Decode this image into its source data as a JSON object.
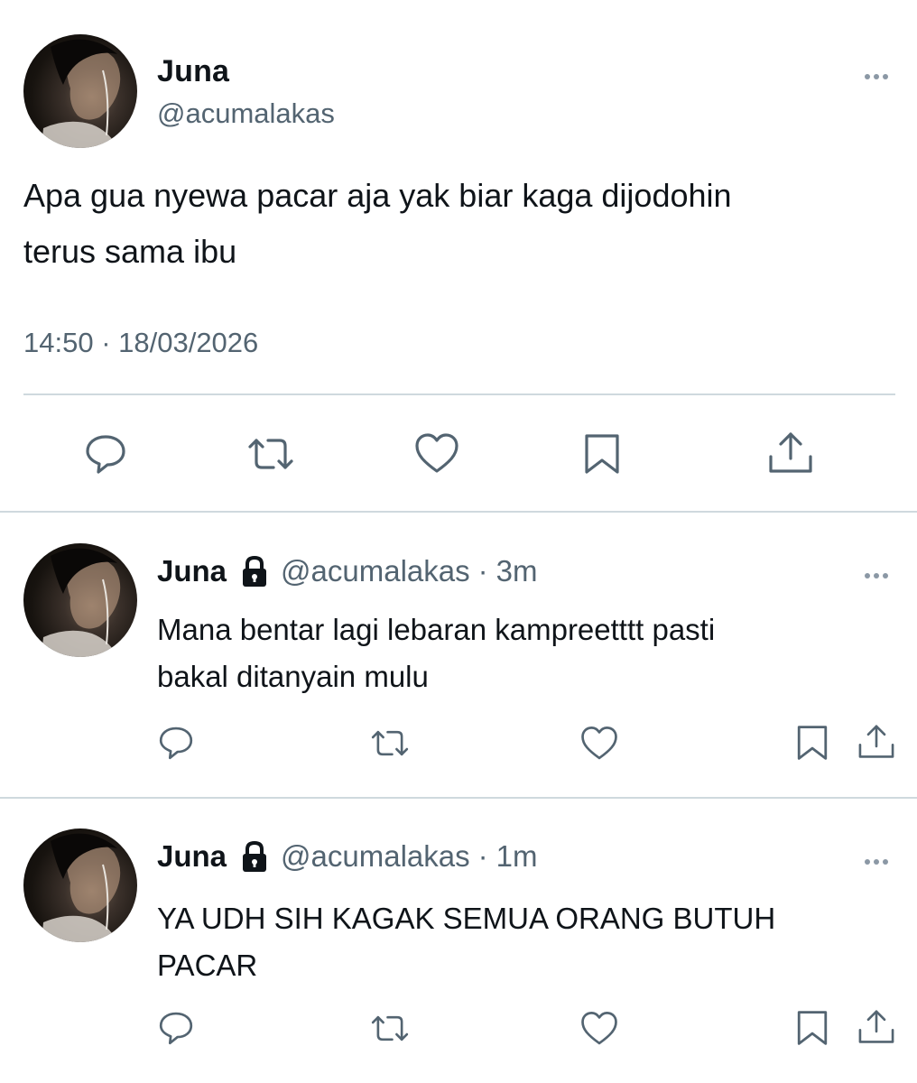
{
  "main_tweet": {
    "author_name": "Juna",
    "author_handle": "@acumalakas",
    "text_line1": "Apa gua nyewa pacar aja yak biar kaga dijodohin",
    "text_line2": "terus sama ibu",
    "timestamp": "14:50 · 18/03/2026"
  },
  "replies": [
    {
      "author_name": "Juna",
      "author_handle": "@acumalakas",
      "separator": "·",
      "age": "3m",
      "text_line1": "Mana bentar lagi lebaran kampreetttt pasti",
      "text_line2": "bakal ditanyain mulu"
    },
    {
      "author_name": "Juna",
      "author_handle": "@acumalakas",
      "separator": "·",
      "age": "1m",
      "text_line1": "YA UDH SIH KAGAK SEMUA ORANG BUTUH",
      "text_line2": "PACAR"
    }
  ],
  "icons": {
    "reply": "speech-bubble-icon",
    "retweet": "retweet-arrows-icon",
    "like": "heart-icon",
    "bookmark": "bookmark-icon",
    "share": "share-upload-icon",
    "more": "more-dots-icon",
    "protected": "lock-icon"
  },
  "colors": {
    "text": "#0f1419",
    "secondary": "#536471",
    "divider": "#cfd9de"
  }
}
